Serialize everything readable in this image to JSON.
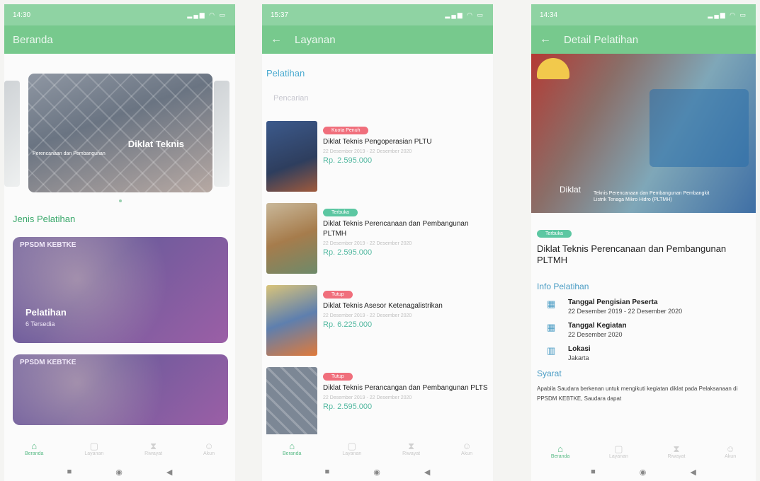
{
  "colors": {
    "primary": "#77c98d",
    "accent": "#4a9cc4",
    "price": "#52b8a0",
    "full": "#f06f7c",
    "open": "#5cc7a2",
    "closed": "#f06f7c"
  },
  "screen1": {
    "status": {
      "time": "14:30",
      "icons": "signal wifi battery"
    },
    "title": "Beranda",
    "banner": {
      "title": "Diklat Teknis",
      "subtitle": "Perencanaan dan Pembangunan"
    },
    "section_title": "Jenis Pelatihan",
    "categories": [
      {
        "logo": "PPSDM KEBTKE",
        "name": "Pelatihan",
        "count": "6 Tersedia"
      },
      {
        "logo": "PPSDM KEBTKE",
        "name": "",
        "count": ""
      }
    ]
  },
  "screen2": {
    "status": {
      "time": "15:37",
      "icons": "signal wifi battery"
    },
    "title": "Layanan",
    "section_title": "Pelatihan",
    "search_placeholder": "Pencarian",
    "courses": [
      {
        "badge": "Kuota Penuh",
        "title": "Diklat Teknis Pengoperasian PLTU",
        "date": "22 Desember 2019 - 22 Desember 2020",
        "price": "Rp. 2.595.000"
      },
      {
        "badge": "Terbuka",
        "title": "Diklat Teknis Perencanaan dan Pembangunan PLTMH",
        "date": "22 Desember 2019 - 22 Desember 2020",
        "price": "Rp. 2.595.000"
      },
      {
        "badge": "Tutup",
        "title": "Diklat Teknis Asesor Ketenagalistrikan",
        "date": "22 Desember 2019 - 22 Desember 2020",
        "price": "Rp. 6.225.000"
      },
      {
        "badge": "Tutup",
        "title": "Diklat Teknis Perancangan dan Pembangunan PLTS",
        "date": "22 Desember 2019 - 22 Desember 2020",
        "price": "Rp. 2.595.000"
      }
    ]
  },
  "screen3": {
    "status": {
      "time": "14:34",
      "icons": "signal wifi battery"
    },
    "title": "Detail Pelatihan",
    "hero": {
      "title": "Diklat",
      "subtitle": "Teknis Perencanaan dan Pembangunan Pembangkit Listrik Tenaga Mikro Hidro (PLTMH)"
    },
    "badge": "Terbuka",
    "course_title": "Diklat Teknis Perencanaan dan Pembangunan PLTMH",
    "info_title": "Info Pelatihan",
    "info": [
      {
        "icon": "calendar-icon",
        "label": "Tanggal Pengisian Peserta",
        "value": "22 Desember 2019 - 22 Desember 2020"
      },
      {
        "icon": "calendar-icon",
        "label": "Tanggal Kegiatan",
        "value": "22 Desember 2020"
      },
      {
        "icon": "map-icon",
        "label": "Lokasi",
        "value": "Jakarta"
      }
    ],
    "syarat_title": "Syarat",
    "syarat_text": "Apabila Saudara berkenan untuk mengikuti kegiatan diklat pada Pelaksanaan di PPSDM KEBTKE, Saudara dapat"
  },
  "bottom_nav": [
    "Beranda",
    "Layanan",
    "Riwayat",
    "Akun"
  ]
}
